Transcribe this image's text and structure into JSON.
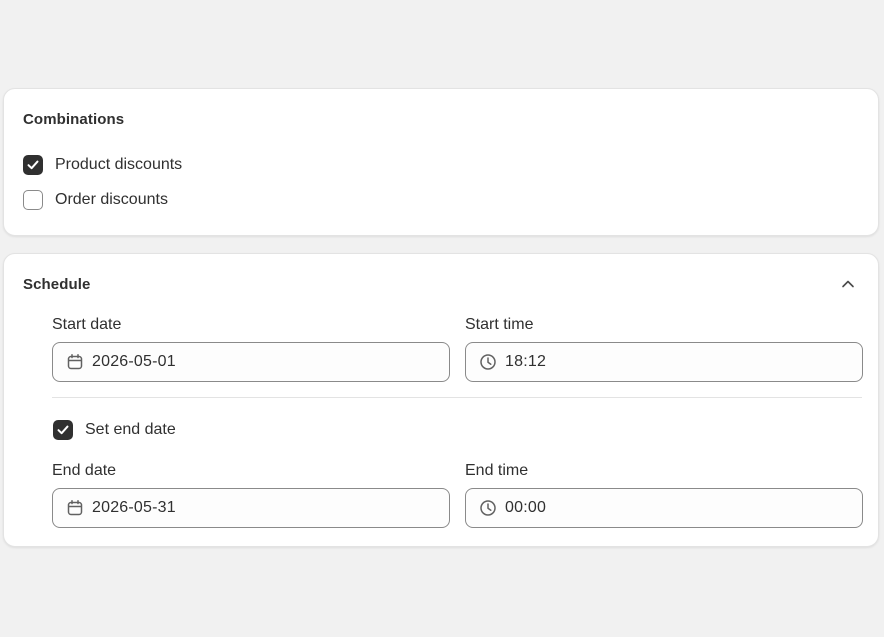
{
  "combinations": {
    "title": "Combinations",
    "options": [
      {
        "label": "Product discounts",
        "checked": true
      },
      {
        "label": "Order discounts",
        "checked": false
      }
    ]
  },
  "schedule": {
    "title": "Schedule",
    "collapse_icon": "chevron-up-icon",
    "start_date": {
      "label": "Start date",
      "value": "2026-05-01",
      "icon": "calendar-icon"
    },
    "start_time": {
      "label": "Start time",
      "value": "18:12",
      "icon": "clock-icon"
    },
    "set_end_date": {
      "label": "Set end date",
      "checked": true
    },
    "end_date": {
      "label": "End date",
      "value": "2026-05-31",
      "icon": "calendar-icon"
    },
    "end_time": {
      "label": "End time",
      "value": "00:00",
      "icon": "clock-icon"
    }
  },
  "colors": {
    "page_background": "#f1f1f1",
    "card_background": "#ffffff",
    "checkbox_checked": "#303030",
    "text": "#303030",
    "border": "#8a8a8a"
  }
}
